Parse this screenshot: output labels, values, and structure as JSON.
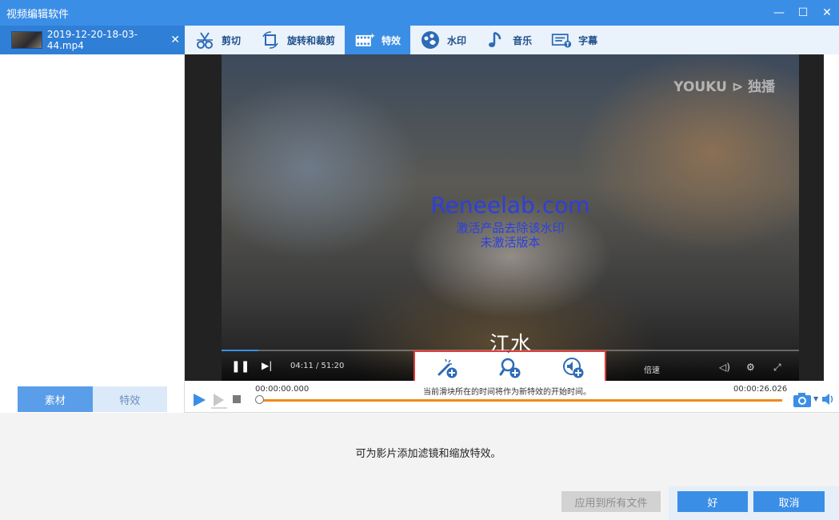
{
  "window": {
    "title": "视频编辑软件",
    "controls": [
      "—",
      "☐",
      "✕"
    ]
  },
  "file_tab": {
    "name": "2019-12-20-18-03-44.mp4",
    "close": "✕"
  },
  "toolbar": {
    "tabs": [
      {
        "label": "剪切",
        "icon": "scissors-icon"
      },
      {
        "label": "旋转和裁剪",
        "icon": "rotate-crop-icon"
      },
      {
        "label": "特效",
        "icon": "effects-film-icon",
        "active": true
      },
      {
        "label": "水印",
        "icon": "watermark-icon"
      },
      {
        "label": "音乐",
        "icon": "music-note-icon"
      },
      {
        "label": "字幕",
        "icon": "subtitle-icon"
      }
    ]
  },
  "left_tabs": {
    "material": "素材",
    "effects": "特效"
  },
  "video": {
    "brand_watermark": "YOUKU ⊳ 独播",
    "overlay_line1": "Reneelab.com",
    "overlay_line2": "激活产品去除该水印",
    "overlay_line3": "未激活版本",
    "subtitle": "江水",
    "player_time": "04:11 / 51:20",
    "speed_label": "倍速"
  },
  "effect_buttons": [
    {
      "name": "add-filter",
      "icon": "magic-wand-plus-icon"
    },
    {
      "name": "add-zoom",
      "icon": "zoom-plus-icon"
    },
    {
      "name": "add-audio-effect",
      "icon": "speaker-plus-icon"
    }
  ],
  "timeline": {
    "start_time": "00:00:00.000",
    "end_time": "00:00:26.026",
    "hint": "当前滑块所在的时间将作为新特效的开始时间。"
  },
  "bottom": {
    "description": "可为影片添加滤镜和缩放特效。",
    "apply_all": "应用到所有文件",
    "ok": "好",
    "cancel": "取消"
  },
  "colors": {
    "accent": "#3b8ee6",
    "timeline_track": "#f08a1c",
    "highlight_border": "#e03a3a",
    "watermark_text": "#2c3fe0"
  }
}
